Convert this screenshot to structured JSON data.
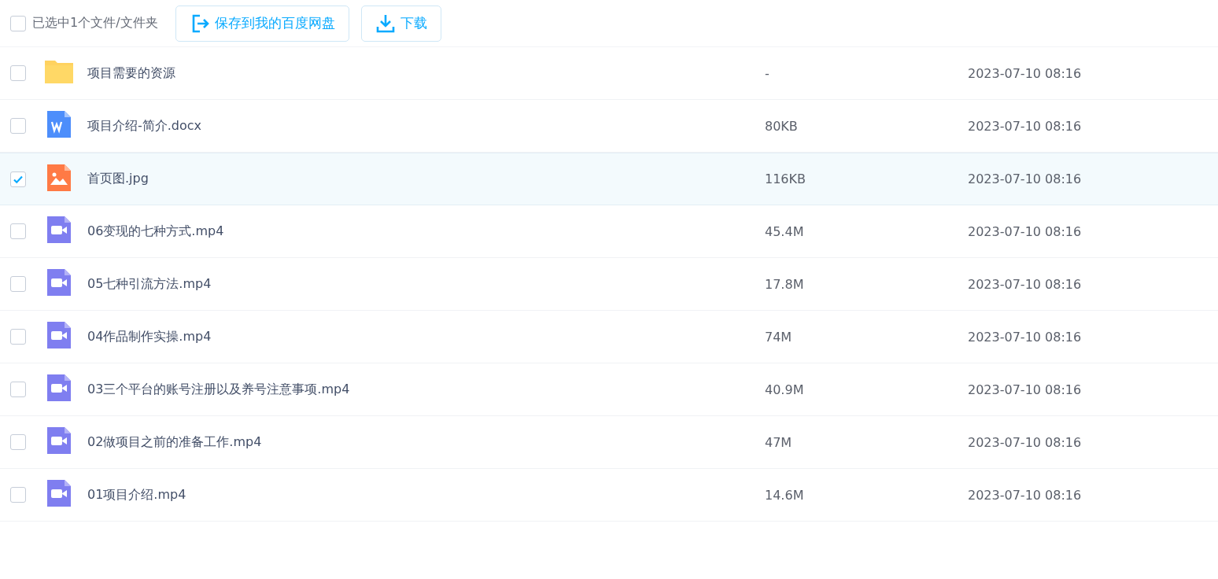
{
  "toolbar": {
    "select_all": {
      "checked": false,
      "label": "已选中1个文件/文件夹"
    },
    "buttons": [
      {
        "kind": "save",
        "label": "保存到我的百度网盘"
      },
      {
        "kind": "download",
        "label": "下载"
      }
    ]
  },
  "files": [
    {
      "kind": "folder",
      "name": "项目需要的资源",
      "size": "-",
      "modified": "2023-07-10 08:16",
      "selected": false
    },
    {
      "kind": "doc",
      "name": "项目介绍-简介.docx",
      "size": "80KB",
      "modified": "2023-07-10 08:16",
      "selected": false
    },
    {
      "kind": "image",
      "name": "首页图.jpg",
      "size": "116KB",
      "modified": "2023-07-10 08:16",
      "selected": true
    },
    {
      "kind": "video",
      "name": "06变现的七种方式.mp4",
      "size": "45.4M",
      "modified": "2023-07-10 08:16",
      "selected": false
    },
    {
      "kind": "video",
      "name": "05七种引流方法.mp4",
      "size": "17.8M",
      "modified": "2023-07-10 08:16",
      "selected": false
    },
    {
      "kind": "video",
      "name": "04作品制作实操.mp4",
      "size": "74M",
      "modified": "2023-07-10 08:16",
      "selected": false
    },
    {
      "kind": "video",
      "name": "03三个平台的账号注册以及养号注意事项.mp4",
      "size": "40.9M",
      "modified": "2023-07-10 08:16",
      "selected": false
    },
    {
      "kind": "video",
      "name": "02做项目之前的准备工作.mp4",
      "size": "47M",
      "modified": "2023-07-10 08:16",
      "selected": false
    },
    {
      "kind": "video",
      "name": "01项目介绍.mp4",
      "size": "14.6M",
      "modified": "2023-07-10 08:16",
      "selected": false
    }
  ]
}
